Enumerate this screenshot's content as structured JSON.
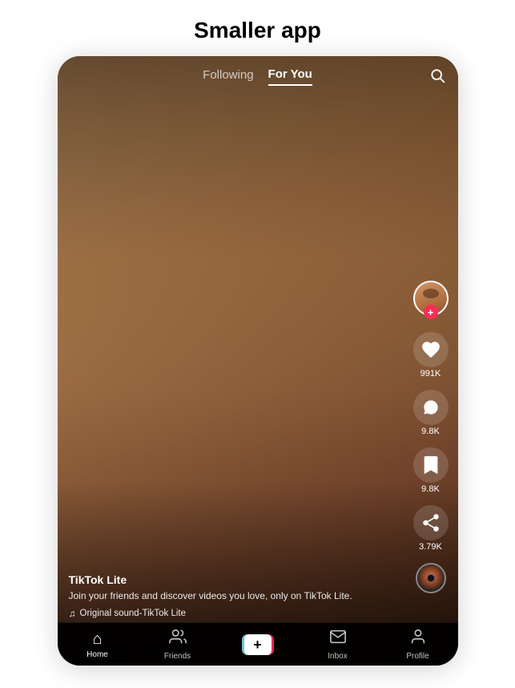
{
  "header": {
    "title": "Smaller app"
  },
  "nav": {
    "following_label": "Following",
    "for_you_label": "For You",
    "search_icon": "search-icon"
  },
  "actions": {
    "like_count": "991K",
    "comment_count": "9.8K",
    "bookmark_count": "9.8K",
    "share_count": "3.79K"
  },
  "video_info": {
    "username": "TikTok Lite",
    "description": "Join your friends and discover videos you love, only on TikTok Lite.",
    "music": "Original sound-TikTok Lite"
  },
  "bottom_nav": {
    "home_label": "Home",
    "friends_label": "Friends",
    "add_label": "+",
    "inbox_label": "Inbox",
    "profile_label": "Profile"
  }
}
